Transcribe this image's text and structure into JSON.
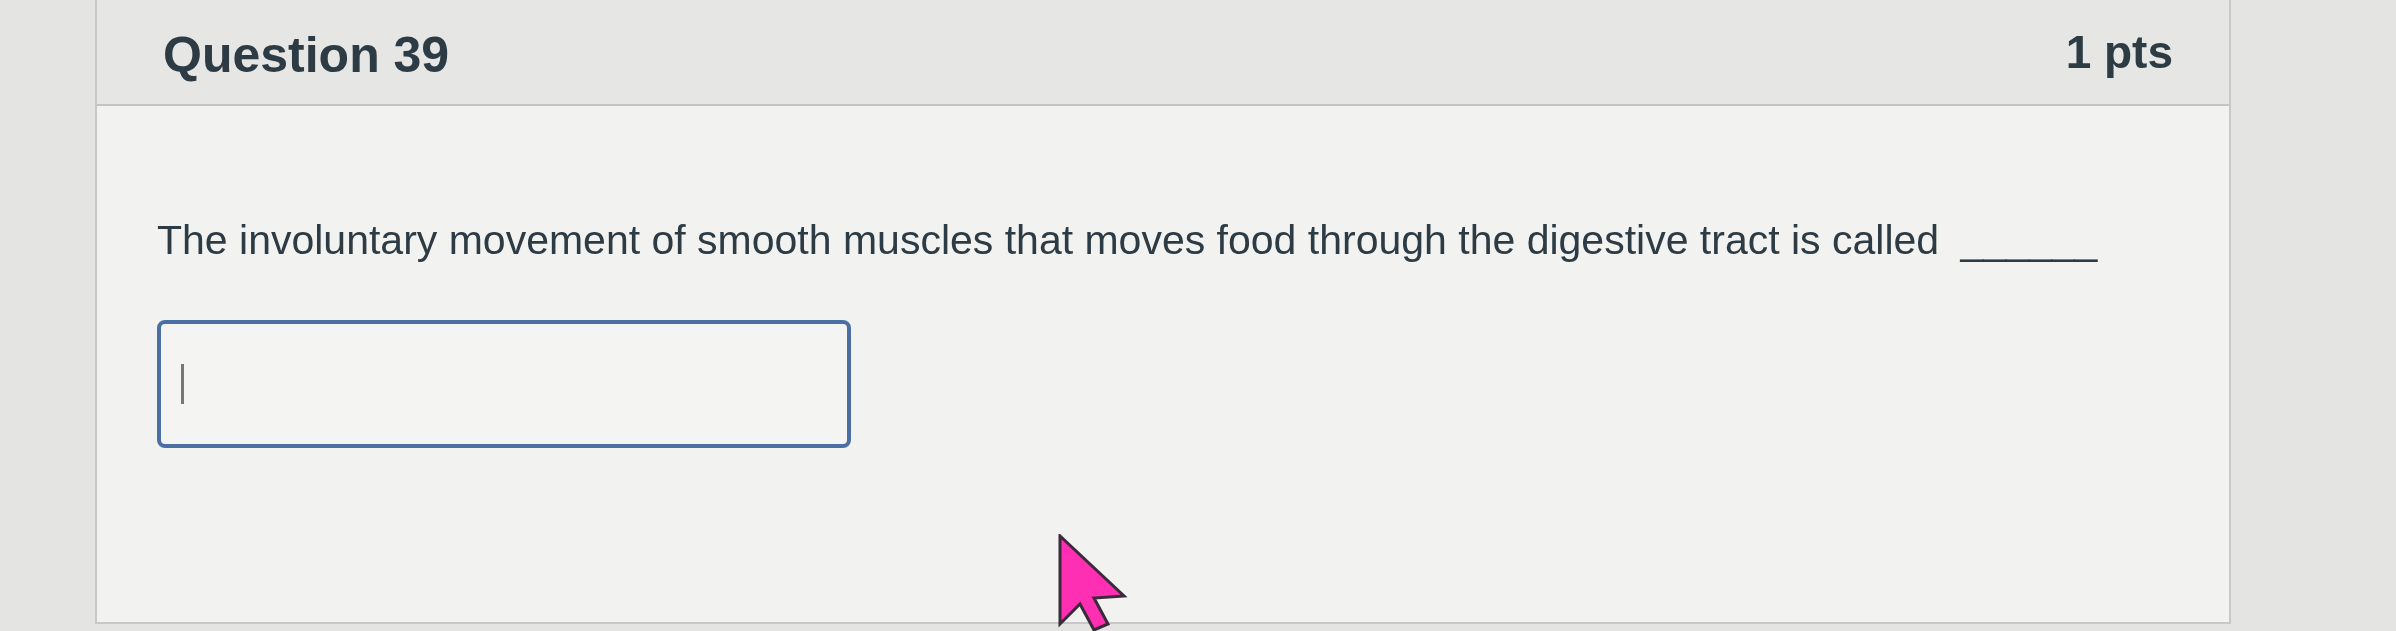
{
  "question": {
    "title": "Question 39",
    "points": "1 pts",
    "text": "The involuntary movement of smooth muscles that moves food through the digestive tract is called",
    "blank": "______"
  },
  "answer": {
    "focused": true
  }
}
